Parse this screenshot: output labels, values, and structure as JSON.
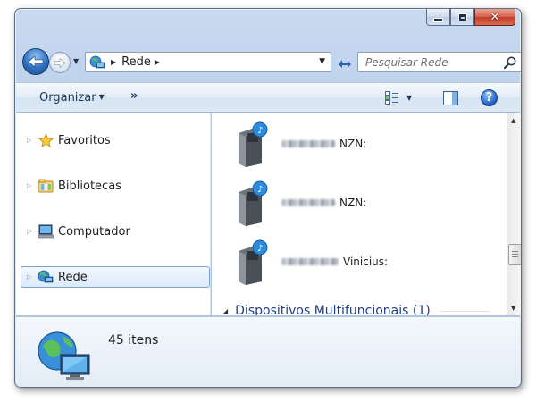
{
  "window": {
    "caption_buttons": {
      "minimize": "minimize-icon",
      "maximize": "maximize-icon",
      "close": "close-icon",
      "close_glyph": "✕"
    }
  },
  "navigation": {
    "address": {
      "location": "Rede",
      "icon": "network-icon"
    },
    "search": {
      "placeholder": "Pesquisar Rede"
    }
  },
  "toolbar": {
    "organize_label": "Organizar",
    "more_label": "»",
    "help_label": "?"
  },
  "nav_pane": {
    "items": [
      {
        "label": "Favoritos",
        "icon": "star-icon",
        "selected": false
      },
      {
        "label": "Bibliotecas",
        "icon": "libraries-icon",
        "selected": false
      },
      {
        "label": "Computador",
        "icon": "computer-icon",
        "selected": false
      },
      {
        "label": "Rede",
        "icon": "network-icon",
        "selected": true
      }
    ]
  },
  "content": {
    "items": [
      {
        "name_suffix": "NZN:",
        "icon": "media-device-icon"
      },
      {
        "name_suffix": "NZN:",
        "icon": "media-device-icon"
      },
      {
        "name_suffix": "Vinicius:",
        "icon": "media-device-icon"
      }
    ],
    "group_header": "Dispositivos Multifuncionais (1)"
  },
  "details": {
    "count_text": "45 itens",
    "icon": "network-globe-icon"
  },
  "colors": {
    "chrome": "#b4cbe6",
    "selection": "#dbeaf9",
    "group_header": "#1e3f89",
    "close_button": "#c33e26"
  }
}
